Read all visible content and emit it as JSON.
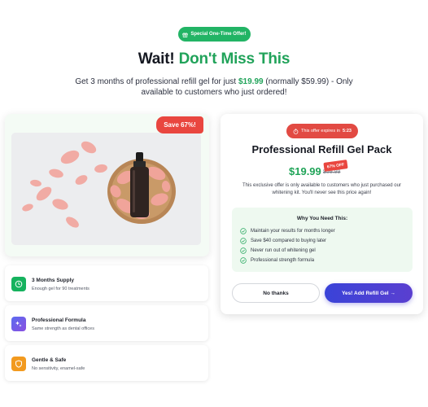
{
  "top_badge": {
    "label": "Special One-Time Offer!",
    "icon": "gift-icon"
  },
  "headline": {
    "lead": "Wait!",
    "accent": "Don't Miss This"
  },
  "subline": {
    "before": "Get 3 months of professional refill gel for just ",
    "price": "$19.99",
    "after": " (normally $59.99) - Only available to customers who just ordered!"
  },
  "hero": {
    "save_badge": "Save 67%!",
    "image": "serum-bottle-with-rose-petals"
  },
  "features": [
    {
      "title": "3 Months Supply",
      "subtitle": "Enough gel for 90 treatments",
      "icon": "clock-icon",
      "color": "#16b25e"
    },
    {
      "title": "Professional Formula",
      "subtitle": "Same strength as dental offices",
      "icon": "sparkle-icon",
      "color": "#6a5ae6"
    },
    {
      "title": "Gentle & Safe",
      "subtitle": "No sensitivity, enamel-safe",
      "icon": "shield-icon",
      "color": "#f29a1f"
    }
  ],
  "offer": {
    "timer_prefix": "This offer expires in",
    "timer_value": "5:23",
    "title": "Professional Refill Gel Pack",
    "price": "$19.99",
    "old_price": "$59.99",
    "off_badge": "67% OFF",
    "description": "This exclusive offer is only available to customers who just purchased our whitening kit. You'll never see this price again!",
    "why_title": "Why You Need This:",
    "why_items": [
      "Maintain your results for months longer",
      "Save $40 compared to buying later",
      "Never run out of whitening gel",
      "Professional strength formula"
    ],
    "decline_label": "No thanks",
    "accept_label": "Yes! Add Refill Gel →"
  },
  "colors": {
    "green": "#21a35a",
    "red": "#e9463f",
    "primary": "#3a43d8"
  }
}
